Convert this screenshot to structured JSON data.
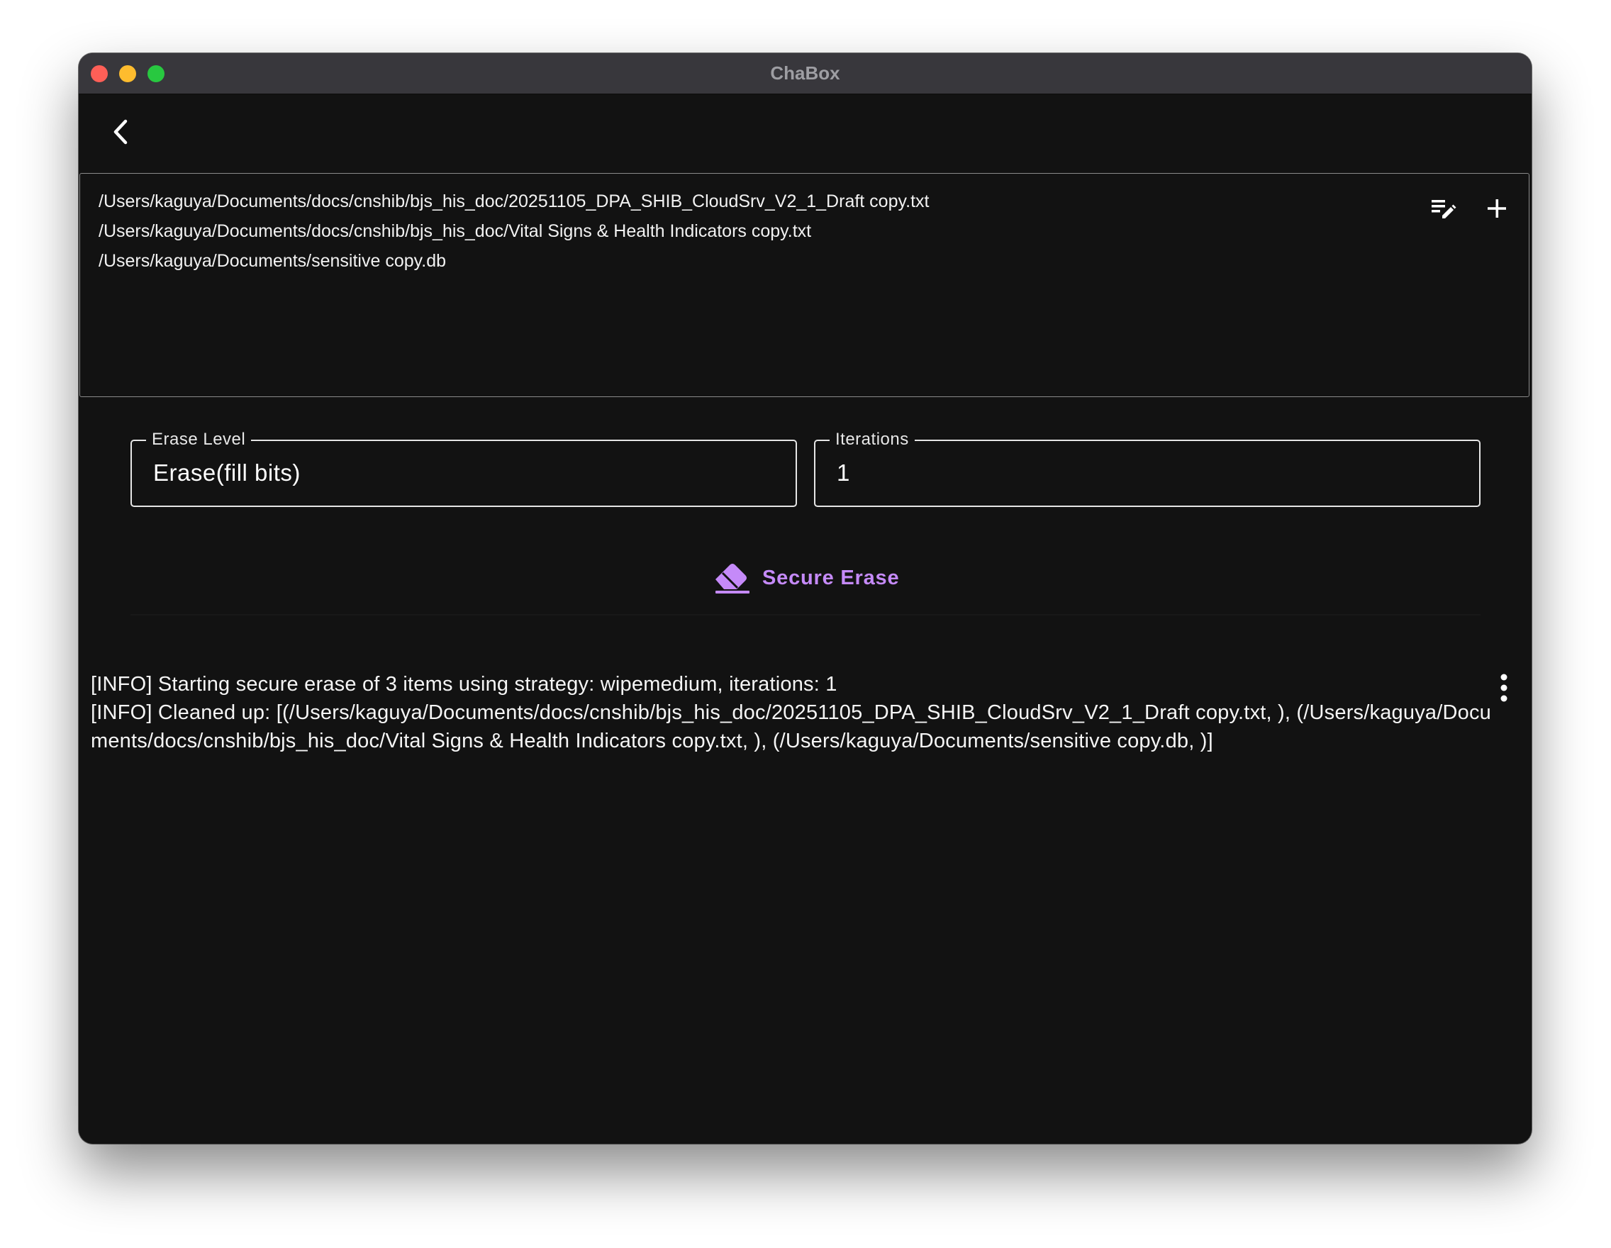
{
  "window": {
    "title": "ChaBox"
  },
  "files": [
    "/Users/kaguya/Documents/docs/cnshib/bjs_his_doc/20251105_DPA_SHIB_CloudSrv_V2_1_Draft copy.txt",
    "/Users/kaguya/Documents/docs/cnshib/bjs_his_doc/Vital Signs & Health Indicators copy.txt",
    "/Users/kaguya/Documents/sensitive copy.db"
  ],
  "erase_level": {
    "label": "Erase Level",
    "value": "Erase(fill bits)"
  },
  "iterations": {
    "label": "Iterations",
    "value": "1"
  },
  "action": {
    "label": "Secure Erase"
  },
  "log": [
    "[INFO] Starting secure erase of 3 items using strategy: wipemedium, iterations: 1",
    "[INFO] Cleaned up: [(/Users/kaguya/Documents/docs/cnshib/bjs_his_doc/20251105_DPA_SHIB_CloudSrv_V2_1_Draft copy.txt, ), (/Users/kaguya/Documents/docs/cnshib/bjs_his_doc/Vital Signs & Health Indicators copy.txt, ), (/Users/kaguya/Documents/sensitive copy.db, )]"
  ],
  "icons": {
    "back": "chevron-left-icon",
    "edit_list": "playlist-edit-icon",
    "add": "plus-icon",
    "erase": "eraser-icon",
    "more": "more-vertical-icon"
  },
  "colors": {
    "accent": "#c58af9",
    "background": "#121212",
    "titlebar": "#38373c",
    "close": "#fe5f57",
    "minimize": "#febc2e",
    "maximize": "#28c840"
  }
}
